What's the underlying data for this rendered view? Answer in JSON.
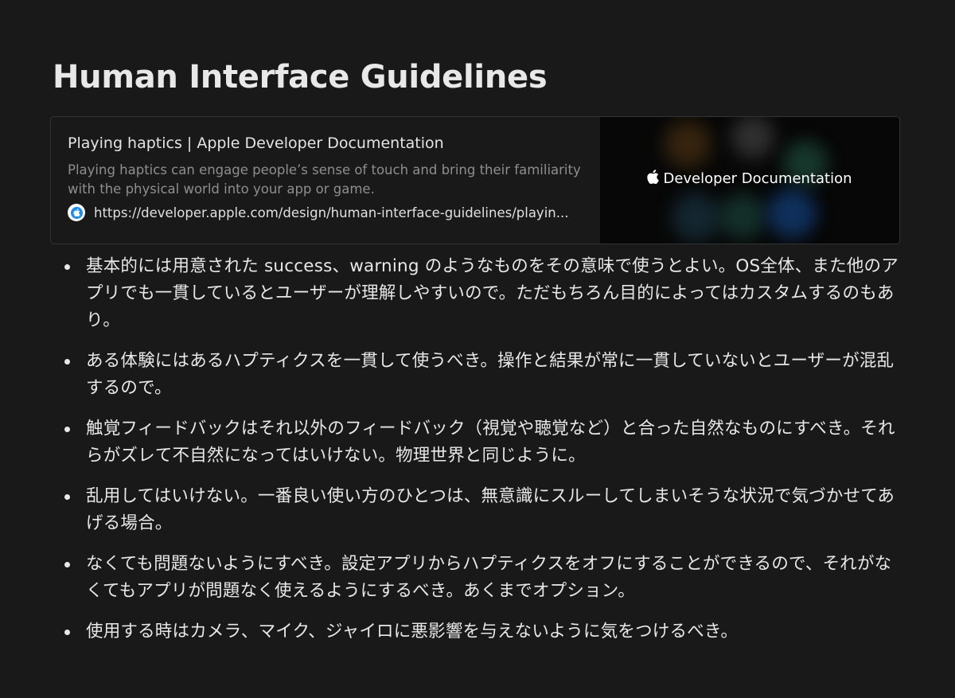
{
  "page": {
    "title": "Human Interface Guidelines"
  },
  "bookmark": {
    "title": "Playing haptics | Apple Developer Documentation",
    "description": "Playing haptics can engage people’s sense of touch and bring their familiarity with the physical world into your app or game.",
    "url": "https://developer.apple.com/design/human-interface-guidelines/playin...",
    "favicon_icon": "apple-developer-icon",
    "image_caption": "Developer Documentation",
    "image_logo_icon": "apple-logo-icon"
  },
  "bullets": [
    "基本的には用意された success、warning のようなものをその意味で使うとよい。OS全体、また他のアプリでも一貫しているとユーザーが理解しやすいので。ただもちろん目的によってはカスタムするのもあり。",
    "ある体験にはあるハプティクスを一貫して使うべき。操作と結果が常に一貫していないとユーザーが混乱するので。",
    "触覚フィードバックはそれ以外のフィードバック（視覚や聴覚など）と合った自然なものにすべき。それらがズレて不自然になってはいけない。物理世界と同じように。",
    "乱用してはいけない。一番良い使い方のひとつは、無意識にスルーしてしまいそうな状況で気づかせてあげる場合。",
    "なくても問題ないようにすべき。設定アプリからハプティクスをオフにすることができるので、それがなくてもアプリが問題なく使えるようにするべき。あくまでオプション。",
    "使用する時はカメラ、マイク、ジャイロに悪影響を与えないように気をつけるべき。"
  ],
  "colors": {
    "background": "#191919",
    "text": "#e8e8e8",
    "muted_text": "#8e8e8e",
    "border": "#333333",
    "favicon_blue": "#1d8cf0"
  }
}
